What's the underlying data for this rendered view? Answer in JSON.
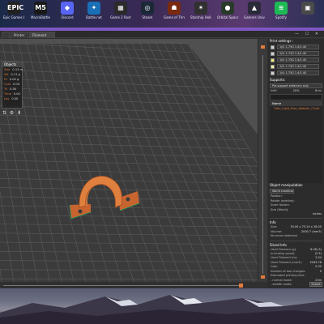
{
  "desktop": {
    "icons": [
      {
        "name": "epic-games-launcher",
        "label": "Epic Games Launcher",
        "color": "#222222",
        "glyph": "EPIC"
      },
      {
        "name": "macrobattle",
        "label": "MacroBattle",
        "color": "#1a1a1a",
        "glyph": "M5"
      },
      {
        "name": "discord",
        "label": "Discord",
        "color": "#5865f2",
        "glyph": "◆"
      },
      {
        "name": "battlenet",
        "label": "Battle.net",
        "color": "#1a6fb5",
        "glyph": "✦"
      },
      {
        "name": "game-extra",
        "label": "Game 2 Rostrum",
        "color": "#2a2a2a",
        "glyph": "▦"
      },
      {
        "name": "steam",
        "label": "Steam",
        "color": "#1b2838",
        "glyph": "◎"
      },
      {
        "name": "game-of-thrones",
        "label": "Game of Thrones 2",
        "color": "#7a2a10",
        "glyph": "☗"
      },
      {
        "name": "hollow",
        "label": "Starship Hollow",
        "color": "#303030",
        "glyph": "✶"
      },
      {
        "name": "orbit",
        "label": "Orbital Space",
        "color": "#2a3a2a",
        "glyph": "●"
      },
      {
        "name": "gameworks",
        "label": "Gamers Universe",
        "color": "#2a2a3a",
        "glyph": "▲"
      },
      {
        "name": "spotify",
        "label": "Spotify",
        "color": "#1db954",
        "glyph": "≋"
      },
      {
        "name": "app-12",
        "label": "",
        "color": "#4a4a4a",
        "glyph": "▣"
      }
    ]
  },
  "window": {
    "tabs": [
      "",
      "Printer Settings",
      "Filament Settings"
    ],
    "controls": "— ☐ ✕"
  },
  "stats": {
    "header": "Objects",
    "rows": [
      {
        "k": "Size",
        "v": "0.13 m"
      },
      {
        "k": "Vol",
        "v": "0.11 g"
      },
      {
        "k": "Fil",
        "v": "0.00 g"
      },
      {
        "k": "Cost",
        "v": "0.00"
      },
      {
        "k": "Tri",
        "v": "0.00"
      },
      {
        "k": "Time",
        "v": "0.00"
      },
      {
        "k": "Lay",
        "v": "0.00"
      }
    ]
  },
  "panel": {
    "print_settings_title": "Print settings :",
    "filaments": [
      {
        "label": "1/4: 1.75G 1.4/1.40",
        "color": "#cfcfcf"
      },
      {
        "label": "1/4: 1.75G 1.4/1.40",
        "color": "#cfcfcf"
      },
      {
        "label": "1/4: 1.75G 1.4/1.40",
        "color": "#f2e86d"
      },
      {
        "label": "1/4: 1.75G 1.4/1.40",
        "color": "#f3ef9a"
      },
      {
        "label": "1/4: 1.75G 1.4/1.40",
        "color": "#cfcfcf"
      }
    ],
    "supports_label": "Supports:",
    "supports_value": "Pre-support enforcers only",
    "infill_label": "Infill:",
    "infill_value": "20%",
    "brim_label": "Brim",
    "list_header": "Name",
    "list_items": [
      "Tube_Light_Pipe_Adapter_Circle"
    ],
    "obj_manip_title": "Object manipulation",
    "obj_coord": "World coordinates",
    "manip_rows": [
      {
        "k": "Position:",
        "v": ""
      },
      {
        "k": "Rotate (relative):",
        "v": ""
      },
      {
        "k": "Scale factors:",
        "v": ""
      },
      {
        "k": "Size (World):",
        "v": ""
      },
      {
        "k": "",
        "v": "inches"
      }
    ],
    "info_title": "Info",
    "info_rows": [
      {
        "k": "Size:",
        "v": "30.00 x 75.24 x 28.00"
      },
      {
        "k": "Volume:",
        "v": "2000.7 (mm3)"
      },
      {
        "k": "No errors detected",
        "v": ""
      }
    ],
    "sliced_title": "Sliced Info",
    "sliced_rows": [
      {
        "k": "Used Filament (g):",
        "v": "6.08 (3)"
      },
      {
        "k": "(including spool):",
        "v": "(2.5)"
      },
      {
        "k": "Used Filament (m):",
        "v": "2.04"
      },
      {
        "k": "Used Filament (mm3):",
        "v": "5045.76"
      },
      {
        "k": "Cost:",
        "v": "0.35"
      },
      {
        "k": "Number of tool changes:",
        "v": "0"
      },
      {
        "k": "Estimated printing time:",
        "v": ""
      },
      {
        "k": "- normal mode:",
        "v": "23m"
      },
      {
        "k": "- stealth mode:",
        "v": "24m"
      }
    ],
    "export_label": "Export"
  },
  "colors": {
    "accent": "#e07b3c",
    "plate": "#3a3a3a",
    "grid": "#555555",
    "part": "#d9783e"
  }
}
